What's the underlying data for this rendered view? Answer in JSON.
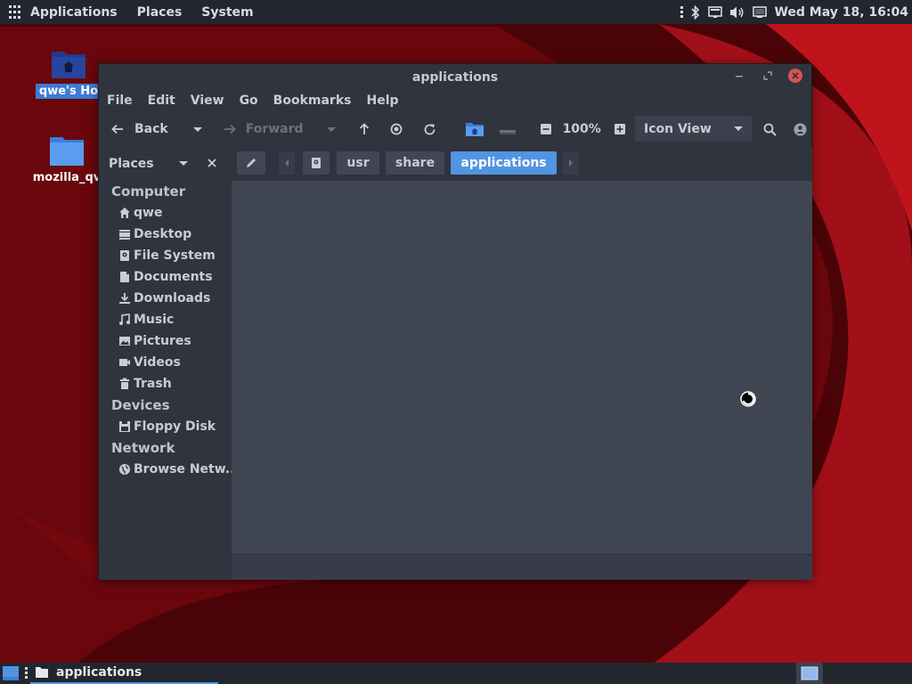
{
  "top_panel": {
    "menus": [
      "Applications",
      "Places",
      "System"
    ],
    "clock": "Wed May 18, 16:04",
    "tray_icons": [
      "bluetooth-icon",
      "network-icon",
      "volume-icon",
      "display-icon"
    ]
  },
  "desktop": {
    "icons": [
      {
        "name": "home-folder-icon",
        "label": "qwe's Ho",
        "selected": true
      },
      {
        "name": "folder-icon",
        "label": "mozilla_qv",
        "selected": false
      }
    ]
  },
  "window": {
    "title": "applications",
    "menubar": [
      "File",
      "Edit",
      "View",
      "Go",
      "Bookmarks",
      "Help"
    ],
    "toolbar": {
      "back_label": "Back",
      "forward_label": "Forward",
      "zoom_level": "100%",
      "view_mode": "Icon View"
    },
    "sidebar": {
      "header": "Places",
      "sections": [
        {
          "title": "Computer",
          "items": [
            {
              "label": "qwe",
              "icon": "home-icon"
            },
            {
              "label": "Desktop",
              "icon": "desktop-icon"
            },
            {
              "label": "File System",
              "icon": "drive-icon"
            },
            {
              "label": "Documents",
              "icon": "document-icon"
            },
            {
              "label": "Downloads",
              "icon": "download-icon"
            },
            {
              "label": "Music",
              "icon": "music-icon"
            },
            {
              "label": "Pictures",
              "icon": "pictures-icon"
            },
            {
              "label": "Videos",
              "icon": "video-icon"
            },
            {
              "label": "Trash",
              "icon": "trash-icon"
            }
          ]
        },
        {
          "title": "Devices",
          "items": [
            {
              "label": "Floppy Disk",
              "icon": "floppy-icon"
            }
          ]
        },
        {
          "title": "Network",
          "items": [
            {
              "label": "Browse Netw...",
              "icon": "globe-icon"
            }
          ]
        }
      ]
    },
    "pathbar": {
      "crumbs": [
        "usr",
        "share",
        "applications"
      ]
    }
  },
  "taskbar": {
    "task_label": "applications"
  },
  "colors": {
    "accent": "#5294e2",
    "panel_bg": "#23262f",
    "window_bg": "#2f343f",
    "content_bg": "#404552",
    "close_red": "#d9534f",
    "desktop_red": "#8a0b12"
  }
}
